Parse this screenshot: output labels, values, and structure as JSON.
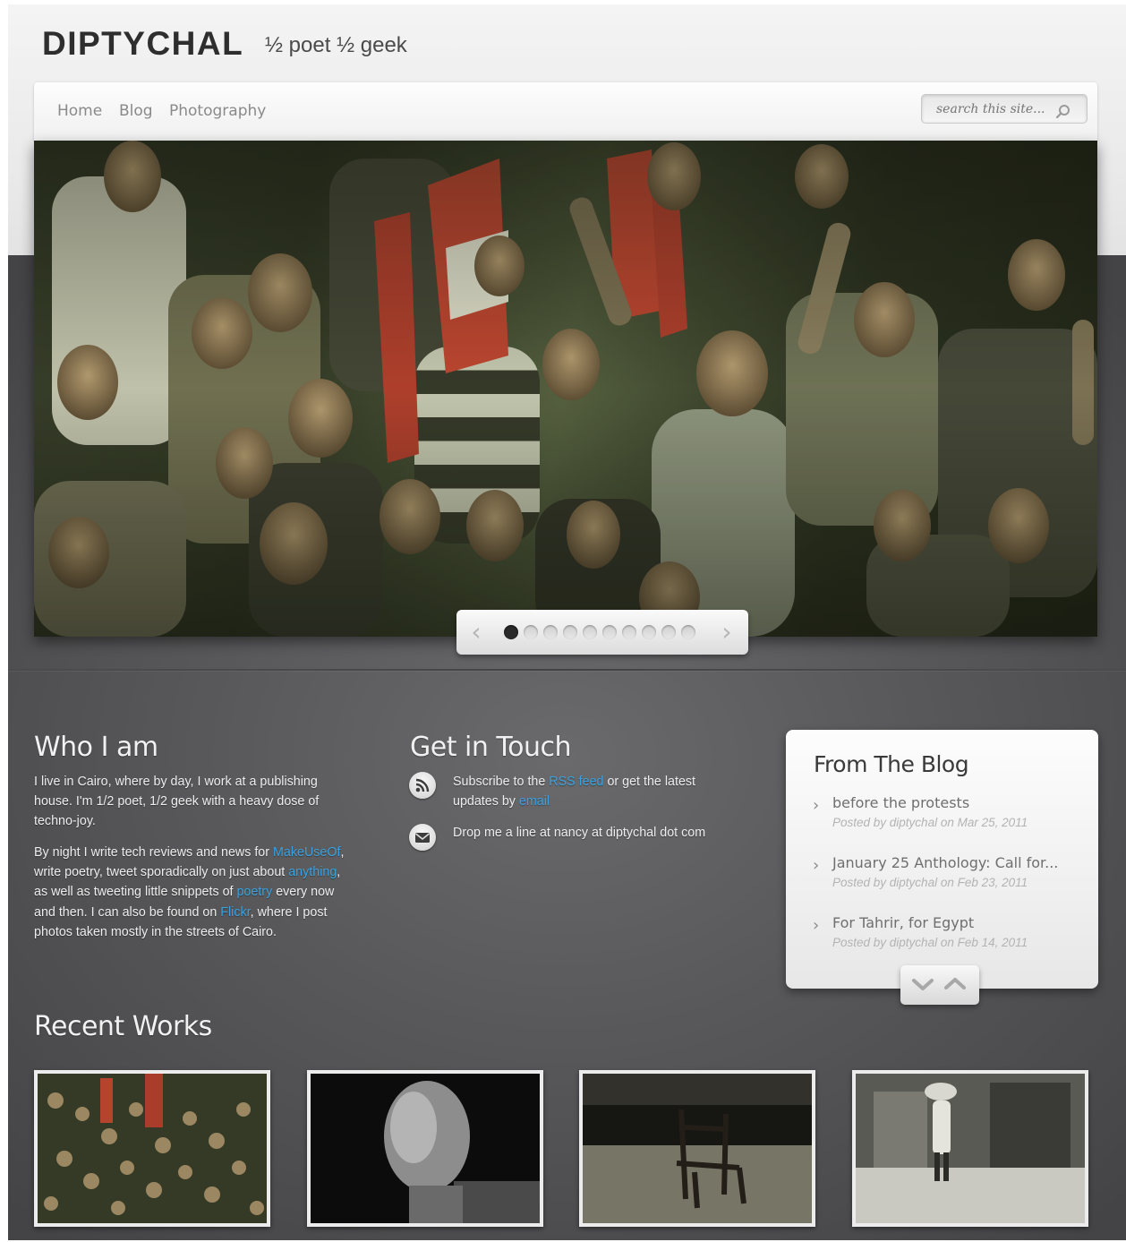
{
  "header": {
    "logo": "DIPTYCHAL",
    "tagline": "½ poet ½ geek"
  },
  "nav": {
    "items": [
      "Home",
      "Blog",
      "Photography"
    ],
    "search_placeholder": "search this site..."
  },
  "slider": {
    "slide_count": 10,
    "active_index": 0
  },
  "who": {
    "heading": "Who I am",
    "p1": "I live in Cairo, where by day, I work at a publishing house. I'm 1/2 poet, 1/2 geek with a heavy dose of techno-joy.",
    "p2_parts": [
      {
        "text": "By night I write tech reviews and news for "
      },
      {
        "text": "MakeUseOf",
        "link": true
      },
      {
        "text": ", write poetry, tweet sporadically on just about "
      },
      {
        "text": "anything",
        "link": true
      },
      {
        "text": ", as well as tweeting little snippets of "
      },
      {
        "text": "poetry",
        "link": true
      },
      {
        "text": " every now and then. I can also be found on "
      },
      {
        "text": "Flickr",
        "link": true
      },
      {
        "text": ", where I post photos taken mostly in the streets of Cairo."
      }
    ]
  },
  "contact": {
    "heading": "Get in Touch",
    "rss_parts": [
      {
        "text": "Subscribe to the "
      },
      {
        "text": "RSS feed",
        "link": true
      },
      {
        "text": " or get the latest updates by "
      },
      {
        "text": "email",
        "link": true
      }
    ],
    "email_text": "Drop me a line at nancy at diptychal dot com"
  },
  "blog": {
    "heading": "From The Blog",
    "items": [
      {
        "title": "before the protests",
        "meta": "Posted by diptychal on Mar 25, 2011"
      },
      {
        "title": "January 25 Anthology: Call for...",
        "meta": "Posted by diptychal on Feb 23, 2011"
      },
      {
        "title": "For Tahrir, for Egypt",
        "meta": "Posted by diptychal on Feb 14, 2011"
      }
    ]
  },
  "recent": {
    "heading": "Recent Works",
    "items": [
      "crowd-photo",
      "portrait-photo",
      "chair-photo",
      "street-photo"
    ]
  },
  "colors": {
    "link": "#3aa2e0",
    "dark_bg": "#58585a",
    "heading": "#f1f1f1"
  }
}
